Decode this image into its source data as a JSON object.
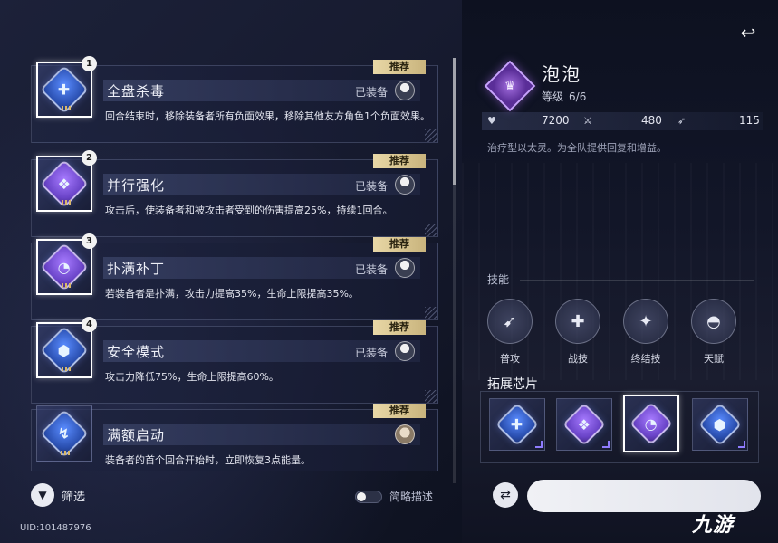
{
  "chips": [
    {
      "number": "1",
      "name": "全盘杀毒",
      "badge": "推荐",
      "status": "已装备",
      "color": "blue",
      "glyph": "✚",
      "description": "回合结束时，移除装备者所有负面效果，移除其他友方角色1个负面效果。"
    },
    {
      "number": "2",
      "name": "并行强化",
      "badge": "推荐",
      "status": "已装备",
      "color": "purple",
      "glyph": "❖",
      "description": "攻击后，使装备者和被攻击者受到的伤害提高25%，持续1回合。"
    },
    {
      "number": "3",
      "name": "扑满补丁",
      "badge": "推荐",
      "status": "已装备",
      "color": "purple",
      "glyph": "◔",
      "description": "若装备者是扑满，攻击力提高35%，生命上限提高35%。"
    },
    {
      "number": "4",
      "name": "安全模式",
      "badge": "推荐",
      "status": "已装备",
      "color": "blue",
      "glyph": "⬢",
      "description": "攻击力降低75%，生命上限提高60%。"
    },
    {
      "number": "",
      "name": "满额启动",
      "badge": "推荐",
      "status": "",
      "color": "blue",
      "glyph": "↯",
      "description": "装备者的首个回合开始时，立即恢复3点能量。"
    }
  ],
  "controls": {
    "filter_label": "筛选",
    "brief_label": "简略描述",
    "brief_enabled": false,
    "uid": "UID:101487976"
  },
  "character": {
    "name": "泡泡",
    "level_label": "等级",
    "level_value": "6/6",
    "stats": {
      "hp": "7200",
      "atk": "480",
      "speed": "115"
    },
    "description": "治疗型以太灵。为全队提供回复和增益。"
  },
  "skills": {
    "header": "技能",
    "items": [
      {
        "label": "普攻",
        "icon": "slash-icon"
      },
      {
        "label": "战技",
        "icon": "heal-cross-icon"
      },
      {
        "label": "终结技",
        "icon": "burst-icon"
      },
      {
        "label": "天赋",
        "icon": "talent-icon"
      }
    ]
  },
  "extension": {
    "title": "拓展芯片",
    "slots": [
      {
        "color": "blue",
        "glyph": "✚",
        "selected": false
      },
      {
        "color": "purple",
        "glyph": "❖",
        "selected": false
      },
      {
        "color": "purple",
        "glyph": "◔",
        "selected": true
      },
      {
        "color": "blue",
        "glyph": "⬢",
        "selected": false
      }
    ]
  },
  "watermark": "九游",
  "colors": {
    "recommend": "#e8d7a6",
    "blue_chip": "#3a66d8",
    "purple_chip": "#7a4fd8"
  }
}
